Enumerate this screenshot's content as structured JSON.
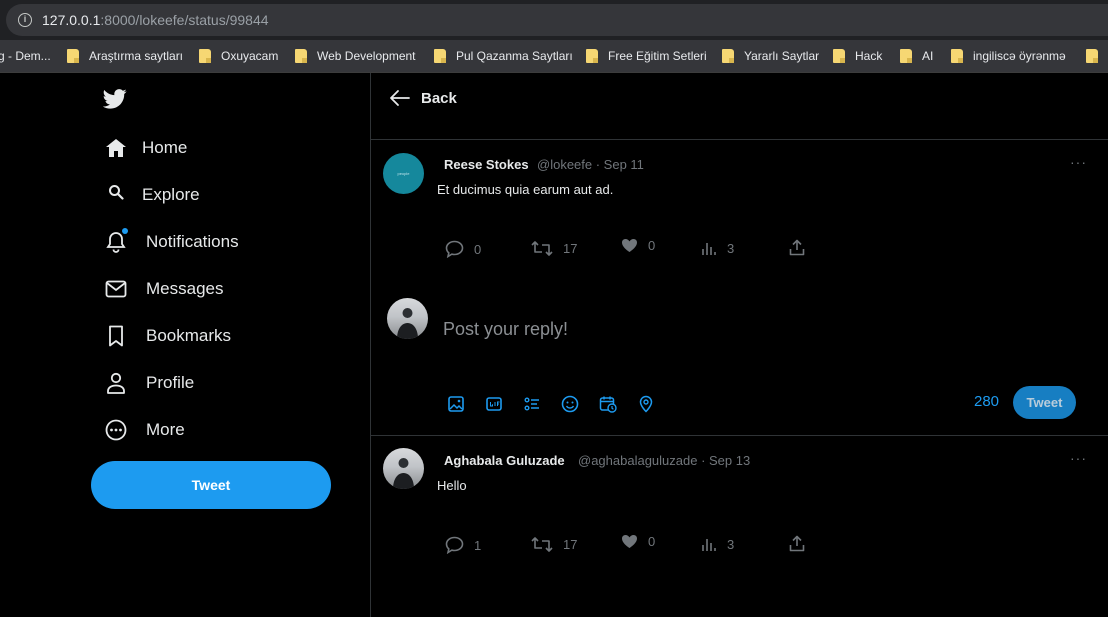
{
  "browser": {
    "url_host": "127.0.0.1",
    "url_rest": ":8000/lokeefe/status/99844",
    "bookmarks": [
      {
        "label": "g - Dem..."
      },
      {
        "label": "Araştırma saytları"
      },
      {
        "label": "Oxuyacam"
      },
      {
        "label": "Web Development"
      },
      {
        "label": "Pul Qazanma Saytları"
      },
      {
        "label": "Free Eğitim Setleri"
      },
      {
        "label": "Yararlı Saytlar"
      },
      {
        "label": "Hack"
      },
      {
        "label": "AI"
      },
      {
        "label": "ingiliscə öyrənmə"
      }
    ]
  },
  "sidebar": {
    "logo_icon": "twitter-bird-icon",
    "items": [
      {
        "label": "Home",
        "icon": "home-icon"
      },
      {
        "label": "Explore",
        "icon": "search-icon"
      },
      {
        "label": "Notifications",
        "icon": "bell-icon"
      },
      {
        "label": "Messages",
        "icon": "envelope-icon"
      },
      {
        "label": "Bookmarks",
        "icon": "bookmark-icon"
      },
      {
        "label": "Profile",
        "icon": "person-icon"
      },
      {
        "label": "More",
        "icon": "more-circle-icon"
      }
    ],
    "tweet_button": "Tweet",
    "accent_color": "#1d9bf0"
  },
  "header": {
    "back_label": "Back"
  },
  "main_tweet": {
    "name": "Reese Stokes",
    "meta": "@lokeefe · Sep 11",
    "avatar_text": "people",
    "body": "Et ducimus quia earum aut ad.",
    "replies": "0",
    "retweets": "17",
    "likes": "0",
    "views": "3",
    "more": "···"
  },
  "reply_composer": {
    "placeholder": "Post your reply!",
    "char_count": "280",
    "button": "Tweet"
  },
  "reply_tweet": {
    "name": "Aghabala Guluzade",
    "meta": "@aghabalaguluzade · Sep 13",
    "body": "Hello",
    "replies": "1",
    "retweets": "17",
    "likes": "0",
    "views": "3",
    "more": "···"
  }
}
